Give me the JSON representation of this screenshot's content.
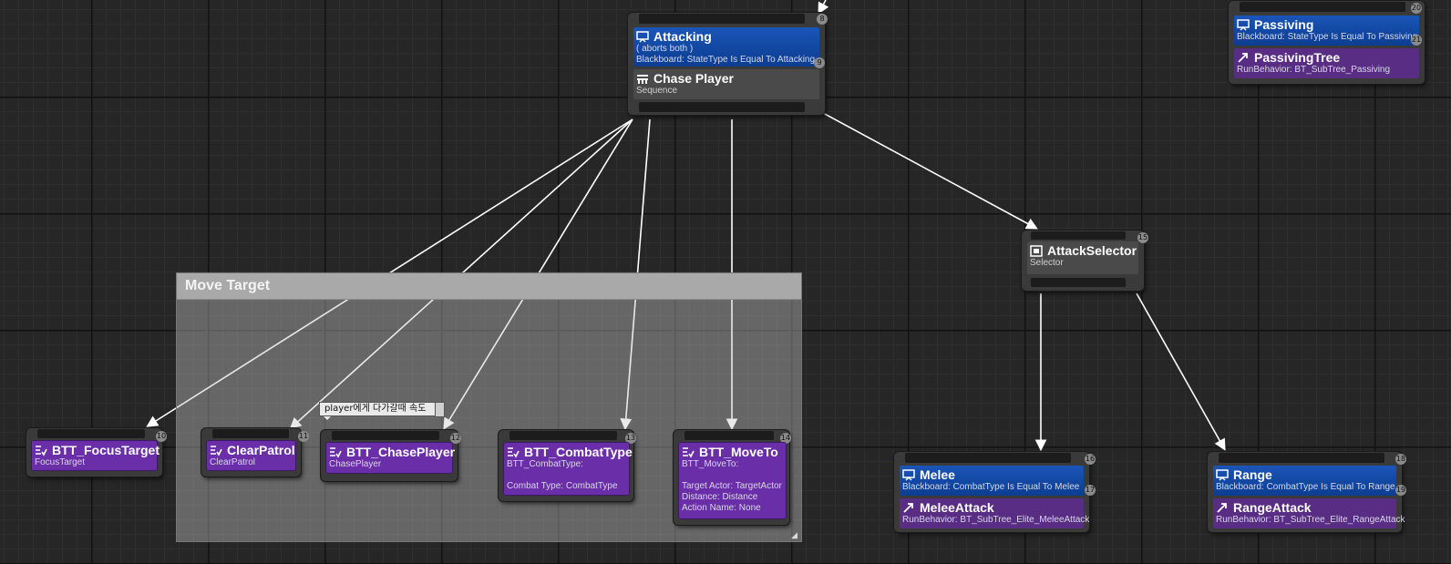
{
  "comment": {
    "title": "Move Target"
  },
  "tooltip": {
    "text": "player에게 다가갈때 속도"
  },
  "nodes": {
    "attacking": {
      "title": "Attacking",
      "aborts": "( aborts both )",
      "condition": "Blackboard: StateType Is Equal To Attacking",
      "badge": "8",
      "badge2": "9",
      "composite_title": "Chase Player",
      "composite_sub": "Sequence"
    },
    "passiving": {
      "title": "Passiving",
      "condition": "Blackboard: StateType Is Equal To Passiving",
      "badge": "20",
      "badge2": "21",
      "subtree_title": "PassivingTree",
      "subtree_sub": "RunBehavior: BT_SubTree_Passiving"
    },
    "attack_selector": {
      "title": "AttackSelector",
      "sub": "Selector",
      "badge": "15"
    },
    "focus_target": {
      "title": "BTT_FocusTarget",
      "sub": "FocusTarget",
      "badge": "10"
    },
    "clear_patrol": {
      "title": "ClearPatrol",
      "sub": "ClearPatrol",
      "badge": "11"
    },
    "chase_player": {
      "title": "BTT_ChasePlayer",
      "sub": "ChasePlayer",
      "badge": "12"
    },
    "combat_type": {
      "title": "BTT_CombatType",
      "line1": "BTT_CombatType:",
      "line2": "Combat Type: CombatType",
      "badge": "13"
    },
    "move_to": {
      "title": "BTT_MoveTo",
      "line1": "BTT_MoveTo:",
      "line2": "Target Actor: TargetActor",
      "line3": "Distance: Distance",
      "line4": "Action Name: None",
      "badge": "14"
    },
    "melee": {
      "title": "Melee",
      "condition": "Blackboard: CombatType Is Equal To Melee",
      "badge": "16",
      "badge2": "17",
      "subtree_title": "MeleeAttack",
      "subtree_sub": "RunBehavior: BT_SubTree_Elite_MeleeAttack"
    },
    "range": {
      "title": "Range",
      "condition": "Blackboard: CombatType Is Equal To Range",
      "badge": "18",
      "badge2": "19",
      "subtree_title": "RangeAttack",
      "subtree_sub": "RunBehavior: BT_SubTree_Elite_RangeAttack"
    }
  },
  "icons": {
    "decorator": "monitor-icon",
    "sequence": "sequence-icon",
    "selector": "selector-icon",
    "task": "task-icon",
    "subtree": "subtree-icon"
  },
  "colors": {
    "decorator": "#0c3d91",
    "task": "#6a2ea8",
    "subtree": "#5a2d84",
    "composite": "#4a4a4a",
    "wire": "#ffffff",
    "comment_title": "#a9a9a9"
  }
}
